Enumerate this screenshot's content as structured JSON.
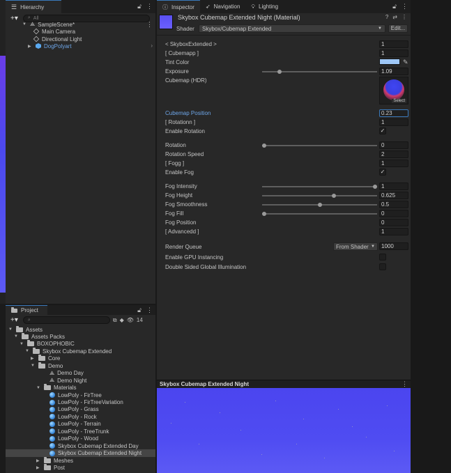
{
  "hierarchy": {
    "tab_label": "Hierarchy",
    "search_placeholder": "All",
    "items": [
      {
        "label": "SampleScene*",
        "type": "scene"
      },
      {
        "label": "Main Camera",
        "type": "object"
      },
      {
        "label": "Directional Light",
        "type": "object"
      },
      {
        "label": "DogPolyart",
        "type": "prefab"
      }
    ]
  },
  "inspector_tabs": [
    "Inspector",
    "Navigation",
    "Lighting"
  ],
  "material": {
    "title": "Skybox Cubemap Extended Night (Material)",
    "shader_label": "Shader",
    "shader_value": "Skybox/Cubemap Extended",
    "edit_label": "Edit...",
    "select_label": "Select",
    "tint_color": "#9ec7f6",
    "properties": [
      {
        "label": "< SkyboxExtended >",
        "kind": "value",
        "value": "1"
      },
      {
        "label": "[ Cubemapp ]",
        "kind": "value",
        "value": "1"
      },
      {
        "label": "Tint Color",
        "kind": "color"
      },
      {
        "label": "Exposure",
        "kind": "slider",
        "value": "1.09",
        "level": 0.14
      },
      {
        "label": "Cubemap (HDR)",
        "kind": "texture"
      },
      {
        "label": "Cubemap Position",
        "kind": "value",
        "value": "0.23",
        "highlight": true
      },
      {
        "label": "[ Rotationn ]",
        "kind": "value",
        "value": "1"
      },
      {
        "label": "Enable Rotation",
        "kind": "check",
        "checked": true
      },
      {
        "label": "Rotation",
        "kind": "slider",
        "value": "0",
        "level": 0
      },
      {
        "label": "Rotation Speed",
        "kind": "value",
        "value": "2"
      },
      {
        "label": "[ Fogg ]",
        "kind": "value",
        "value": "1"
      },
      {
        "label": "Enable Fog",
        "kind": "check",
        "checked": true
      },
      {
        "label": "Fog Intensity",
        "kind": "slider",
        "value": "1",
        "level": 1
      },
      {
        "label": "Fog Height",
        "kind": "slider",
        "value": "0.625",
        "level": 0.63
      },
      {
        "label": "Fog Smoothness",
        "kind": "slider",
        "value": "0.5",
        "level": 0.5
      },
      {
        "label": "Fog Fill",
        "kind": "slider",
        "value": "0",
        "level": 0
      },
      {
        "label": "Fog Position",
        "kind": "value",
        "value": "0"
      },
      {
        "label": "[ Advancedd ]",
        "kind": "value",
        "value": "1"
      }
    ],
    "render_queue": {
      "label": "Render Queue",
      "mode": "From Shader",
      "value": "1000"
    },
    "gpu_instancing": {
      "label": "Enable GPU Instancing",
      "checked": false
    },
    "double_sided_gi": {
      "label": "Double Sided Global Illumination",
      "checked": false
    }
  },
  "preview": {
    "title": "Skybox Cubemap Extended Night"
  },
  "project": {
    "tab_label": "Project",
    "badge_count": "14",
    "tree": [
      {
        "label": "Assets",
        "type": "folder"
      },
      {
        "label": "Assets Packs",
        "type": "folder"
      },
      {
        "label": "BOXOPHOBIC",
        "type": "folder"
      },
      {
        "label": "Skybox Cubemap Extended",
        "type": "folder"
      },
      {
        "label": "Core",
        "type": "folder"
      },
      {
        "label": "Demo",
        "type": "folder"
      },
      {
        "label": "Demo Day",
        "type": "scene"
      },
      {
        "label": "Demo Night",
        "type": "scene"
      },
      {
        "label": "Materials",
        "type": "folder"
      },
      {
        "label": "LowPoly - FirTree",
        "type": "material"
      },
      {
        "label": "LowPoly - FirTreeVariation",
        "type": "material"
      },
      {
        "label": "LowPoly - Grass",
        "type": "material"
      },
      {
        "label": "LowPoly - Rock",
        "type": "material"
      },
      {
        "label": "LowPoly - Terrain",
        "type": "material"
      },
      {
        "label": "LowPoly - TreeTrunk",
        "type": "material"
      },
      {
        "label": "LowPoly - Wood",
        "type": "material"
      },
      {
        "label": "Skybox Cubemap Extended Day",
        "type": "material"
      },
      {
        "label": "Skybox Cubemap Extended Night",
        "type": "material",
        "selected": true
      },
      {
        "label": "Meshes",
        "type": "folder"
      },
      {
        "label": "Post",
        "type": "folder"
      }
    ]
  }
}
